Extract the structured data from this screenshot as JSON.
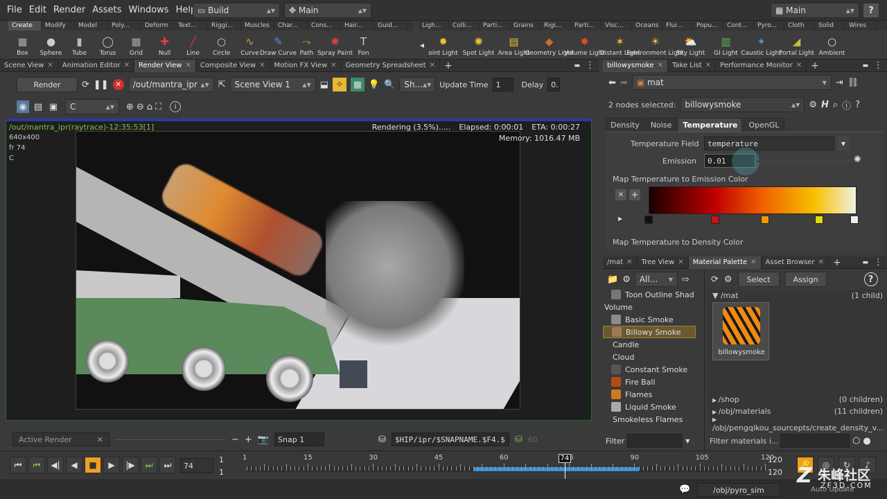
{
  "menu": {
    "items": [
      "File",
      "Edit",
      "Render",
      "Assets",
      "Windows",
      "Help"
    ],
    "desktop": "Build",
    "network": "Main",
    "right_desktop": "Main",
    "help_icon": "?"
  },
  "shelf": {
    "left_tabs": [
      "Create",
      "Modify",
      "Model",
      "Poly...",
      "Deform",
      "Text...",
      "Riggi...",
      "Muscles",
      "Char...",
      "Cons...",
      "Hair...",
      "Guid..."
    ],
    "left_tools": [
      {
        "label": "Box",
        "icon": "box-icon"
      },
      {
        "label": "Sphere",
        "icon": "sphere-icon"
      },
      {
        "label": "Tube",
        "icon": "tube-icon"
      },
      {
        "label": "Torus",
        "icon": "torus-icon"
      },
      {
        "label": "Grid",
        "icon": "grid-icon"
      },
      {
        "label": "Null",
        "icon": "null-icon"
      },
      {
        "label": "Line",
        "icon": "line-icon"
      },
      {
        "label": "Circle",
        "icon": "circle-icon"
      },
      {
        "label": "Curve",
        "icon": "curve-icon"
      },
      {
        "label": "Draw Curve",
        "icon": "draw-curve-icon"
      },
      {
        "label": "Path",
        "icon": "path-icon"
      },
      {
        "label": "Spray Paint",
        "icon": "spray-paint-icon"
      },
      {
        "label": "Fon",
        "icon": "font-icon"
      }
    ],
    "right_tabs": [
      "Ligh...",
      "Colli...",
      "Parti...",
      "Grains",
      "Rigi...",
      "Parti...",
      "Visc...",
      "Oceans",
      "Flui...",
      "Popu...",
      "Cont...",
      "Pyro...",
      "Cloth",
      "Solid",
      "Wires"
    ],
    "right_tools": [
      {
        "label": "oint Light"
      },
      {
        "label": "Spot Light"
      },
      {
        "label": "Area Light"
      },
      {
        "label": "Geometry Light"
      },
      {
        "label": "Volume Light"
      },
      {
        "label": "Distant Light"
      },
      {
        "label": "Environment Light"
      },
      {
        "label": "Sky Light"
      },
      {
        "label": "GI Light"
      },
      {
        "label": "Caustic Light"
      },
      {
        "label": "Portal Light"
      },
      {
        "label": "Ambient"
      }
    ]
  },
  "left_pane": {
    "tabs": [
      "Scene View",
      "Animation Editor",
      "Render View",
      "Composite View",
      "Motion FX View",
      "Geometry Spreadsheet"
    ],
    "active_tab": "Render View",
    "render_button": "Render",
    "output_path": "/out/mantra_ipr",
    "camera": "Scene View 1",
    "sh_button": "Sh...",
    "update_time_label": "Update Time",
    "update_time": "1",
    "delay_label": "Delay",
    "delay": "0.",
    "channel": "C",
    "overlay": {
      "path": "/out/mantra_ipr(raytrace)-12:35:53[1]",
      "resolution": "640x400",
      "frame": "fr 74",
      "channel": "C",
      "rendering": "Rendering (3.5%).....",
      "elapsed": "Elapsed: 0:00:01",
      "eta": "ETA: 0:00:27",
      "memory": "Memory: 1016.47 MB"
    },
    "bottom": {
      "active_render": "Active Render",
      "snap": "Snap",
      "snap_num": "1",
      "snap_path": "$HIP/ipr/$SNAPNAME.$F4.$",
      "snap_val": "60"
    }
  },
  "params": {
    "tabs": [
      "billowysmoke",
      "Take List",
      "Performance Monitor"
    ],
    "path": "mat",
    "nodes_selected_label": "2 nodes selected:",
    "node_name": "billowysmoke",
    "subtabs": [
      "Density",
      "Noise",
      "Temperature",
      "OpenGL"
    ],
    "active_subtab": "Temperature",
    "temp_field_label": "Temperature Field",
    "temp_field": "temperature",
    "emission_label": "Emission",
    "emission": "0.01",
    "map_emission_label": "Map Temperature to Emission Color",
    "map_density_label": "Map Temperature to Density Color",
    "ramp_keys": [
      "#111111",
      "#cc1111",
      "#ee9900",
      "#dddd00",
      "#eeeeee"
    ]
  },
  "palette": {
    "tabs": [
      "/mat",
      "Tree View",
      "Material Palette",
      "Asset Browser"
    ],
    "filter": "All...",
    "select": "Select",
    "assign": "Assign",
    "items": [
      {
        "label": "Toon Outline Shad",
        "thumb": "#777",
        "indent": 1
      },
      {
        "label": "Volume",
        "thumb": "",
        "indent": 0
      },
      {
        "label": "Basic Smoke",
        "thumb": "#8a8a8a",
        "indent": 1
      },
      {
        "label": "Billowy Smoke",
        "thumb": "#9a7a5a",
        "indent": 1,
        "selected": true
      },
      {
        "label": "Candle",
        "thumb": "",
        "indent": 0
      },
      {
        "label": "Cloud",
        "thumb": "",
        "indent": 0
      },
      {
        "label": "Constant Smoke",
        "thumb": "#555",
        "indent": 1
      },
      {
        "label": "Fire Ball",
        "thumb": "#b34c10",
        "indent": 1
      },
      {
        "label": "Flames",
        "thumb": "#d07a1c",
        "indent": 1
      },
      {
        "label": "Liquid Smoke",
        "thumb": "#aaa",
        "indent": 1
      },
      {
        "label": "Smokeless Flames",
        "thumb": "",
        "indent": 0
      }
    ],
    "filter_label": "Filter",
    "tree_root": "/mat",
    "tree_root_count": "(1 child)",
    "material_name": "billowysmoke",
    "tree_items": [
      {
        "label": "/shop",
        "count": "(0 children)"
      },
      {
        "label": "/obj/materials",
        "count": "(11 children)"
      },
      {
        "label": "/obj/pengqikou_sourcepts/create_density_v...",
        "count": ""
      }
    ],
    "filter_materials": "Filter materials i..."
  },
  "timeline": {
    "frame": "74",
    "start": "1",
    "start2": "1",
    "end": "120",
    "end2": "120",
    "ticks": [
      "1",
      "15",
      "30",
      "45",
      "60",
      "75",
      "90",
      "105",
      "120"
    ]
  },
  "status": {
    "path": "/obj/pyro_sim",
    "auto_update": "Auto Update",
    "watermark": "朱峰社区",
    "watermark_sub": "ZF3D.COM"
  },
  "colors": {
    "accent": "#f0a020",
    "panel": "#3a3a3a",
    "render_bg": "#1e1e1e",
    "select": "#6b5a30"
  }
}
